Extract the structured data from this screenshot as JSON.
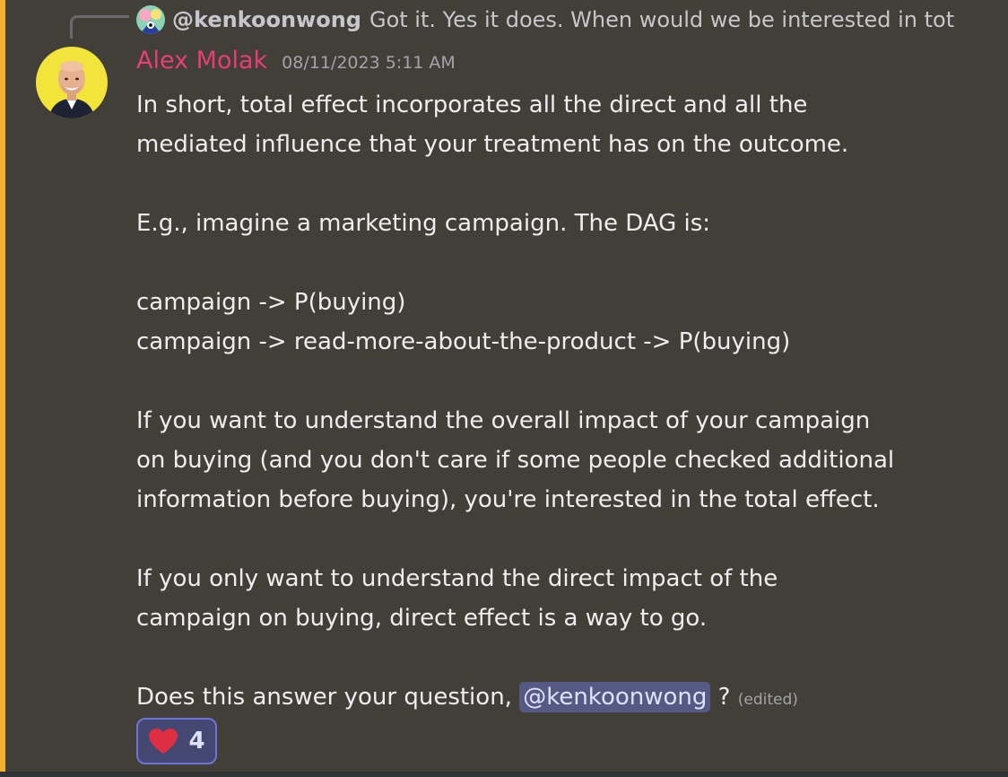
{
  "reply": {
    "author": "@kenkoonwong",
    "text": "Got it. Yes it does. When would we be interested in tot"
  },
  "message": {
    "author": "Alex Molak",
    "timestamp": "08/11/2023 5:11 AM",
    "lines": [
      "In short, total effect incorporates all the direct and all the",
      "mediated influence that your treatment has on the outcome.",
      "",
      "E.g., imagine a marketing campaign. The DAG is:",
      "",
      "campaign -> P(buying)",
      "campaign -> read-more-about-the-product -> P(buying)",
      "",
      "If you want to understand the overall impact of your campaign",
      "on buying (and you don't care if some people checked additional",
      "information before buying), you're interested in the total effect.",
      "",
      "If you only want to understand the direct impact of the",
      "campaign on buying, direct effect is a way to go.",
      ""
    ],
    "question_prefix": "Does this answer your question, ",
    "mention": "@kenkoonwong",
    "question_suffix": " ?",
    "edited_label": "(edited)"
  },
  "reaction": {
    "emoji": "heart-icon",
    "count": "4"
  },
  "colors": {
    "highlight": "#f0b232",
    "author": "#e63f77",
    "mention_bg": "#555a84",
    "reaction_border": "#6e73d6"
  }
}
